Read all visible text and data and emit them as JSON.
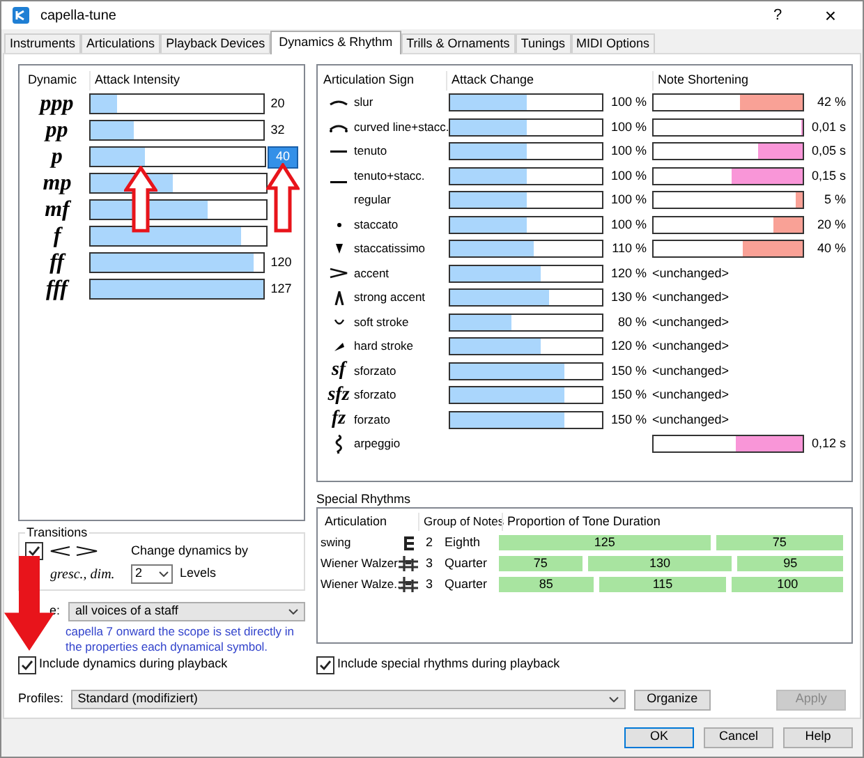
{
  "window": {
    "title": "capella-tune",
    "help": "?",
    "close": "×"
  },
  "tabs": [
    {
      "label": "Instruments",
      "selected": false
    },
    {
      "label": "Articulations",
      "selected": false
    },
    {
      "label": "Playback Devices",
      "selected": false
    },
    {
      "label": "Dynamics & Rhythm",
      "selected": true
    },
    {
      "label": "Trills & Ornaments",
      "selected": false
    },
    {
      "label": "Tunings",
      "selected": false
    },
    {
      "label": "MIDI Options",
      "selected": false
    }
  ],
  "dynamics": {
    "columns": [
      "Dynamic",
      "Attack Intensity"
    ],
    "rows": [
      {
        "dynamic": "ppp",
        "level": 0.16,
        "value": "20",
        "selected": false
      },
      {
        "dynamic": "pp",
        "level": 0.25,
        "value": "32",
        "selected": false
      },
      {
        "dynamic": "p",
        "level": 0.315,
        "value": "40",
        "selected": true
      },
      {
        "dynamic": "mp",
        "level": 0.47,
        "selected": false
      },
      {
        "dynamic": "mf",
        "level": 0.67,
        "selected": false
      },
      {
        "dynamic": "f",
        "level": 0.86,
        "selected": false
      },
      {
        "dynamic": "ff",
        "level": 0.945,
        "value": "120",
        "selected": false
      },
      {
        "dynamic": "fff",
        "level": 1,
        "value": "127",
        "selected": false
      }
    ]
  },
  "transitions": {
    "title": "Transitions",
    "hairpin_checked": true,
    "text_label": "gresc., dim.",
    "change_label": "Change dynamics by",
    "levels_value": "2",
    "levels_label": "Levels"
  },
  "scope": {
    "label": "e:",
    "value": "all voices of a staff"
  },
  "note": "capella 7 onward the scope is set directly in the properties each dynamical symbol.",
  "include_dynamics": {
    "label": "Include dynamics during playback",
    "checked": true
  },
  "articulations": {
    "columns": [
      "Articulation Sign",
      "Attack Change",
      "Note Shortening"
    ],
    "rows": [
      {
        "kind": "slur",
        "name": "slur",
        "attack": {
          "level": 0.5,
          "reading": "100 %"
        },
        "shortening": {
          "level": 0.42,
          "color": "#f9a196",
          "reading": "42 %"
        }
      },
      {
        "kind": "curved-stacc",
        "name": "curved line+stacc.",
        "attack": {
          "level": 0.5,
          "reading": "100 %"
        },
        "shortening": {
          "level": 0.01,
          "color": "#f996d8",
          "reading": "0,01 s"
        }
      },
      {
        "kind": "tenuto",
        "name": "tenuto",
        "attack": {
          "level": 0.5,
          "reading": "100 %"
        },
        "shortening": {
          "level": 0.3,
          "color": "#f996d8",
          "reading": "0,05 s"
        }
      },
      {
        "kind": "tenuto-stacc",
        "name": "tenuto+stacc.",
        "attack": {
          "level": 0.5,
          "reading": "100 %"
        },
        "shortening": {
          "level": 0.48,
          "color": "#f996d8",
          "reading": "0,15 s"
        }
      },
      {
        "kind": "none",
        "name": "regular",
        "attack": {
          "level": 0.5,
          "reading": "100 %"
        },
        "shortening": {
          "level": 0.05,
          "color": "#f9a196",
          "reading": "5 %"
        }
      },
      {
        "kind": "dot",
        "name": "staccato",
        "attack": {
          "level": 0.5,
          "reading": "100 %"
        },
        "shortening": {
          "level": 0.2,
          "color": "#f9a196",
          "reading": "20 %"
        }
      },
      {
        "kind": "wedge",
        "name": "staccatissimo",
        "attack": {
          "level": 0.55,
          "reading": "110 %"
        },
        "shortening": {
          "level": 0.4,
          "color": "#f9a196",
          "reading": "40 %"
        }
      },
      {
        "kind": "accent",
        "name": "accent",
        "attack": {
          "level": 0.6,
          "reading": "120 %"
        },
        "shortening": {
          "reading": "<unchanged>"
        }
      },
      {
        "kind": "strong-accent",
        "name": "strong accent",
        "attack": {
          "level": 0.65,
          "reading": "130 %"
        },
        "shortening": {
          "reading": "<unchanged>"
        }
      },
      {
        "kind": "soft-stroke",
        "name": "soft stroke",
        "attack": {
          "level": 0.4,
          "reading": "80 %"
        },
        "shortening": {
          "reading": "<unchanged>"
        }
      },
      {
        "kind": "hard-stroke",
        "name": "hard stroke",
        "attack": {
          "level": 0.6,
          "reading": "120 %"
        },
        "shortening": {
          "reading": "<unchanged>"
        }
      },
      {
        "kind": "text",
        "sign": "sf",
        "name": "sforzato",
        "attack": {
          "level": 0.75,
          "reading": "150 %"
        },
        "shortening": {
          "reading": "<unchanged>"
        }
      },
      {
        "kind": "text",
        "sign": "sfz",
        "name": "sforzato",
        "attack": {
          "level": 0.75,
          "reading": "150 %"
        },
        "shortening": {
          "reading": "<unchanged>"
        }
      },
      {
        "kind": "text",
        "sign": "fz",
        "name": "forzato",
        "attack": {
          "level": 0.75,
          "reading": "150 %"
        },
        "shortening": {
          "reading": "<unchanged>"
        }
      },
      {
        "kind": "arpeggio",
        "name": "arpeggio",
        "shortening": {
          "level": 0.45,
          "color": "#f996d8",
          "reading": "0,12 s"
        }
      }
    ]
  },
  "special_rhythms": {
    "title": "Special Rhythms",
    "columns": [
      "Articulation",
      "Group of Notes",
      "Proportion of Tone Duration"
    ],
    "rows": [
      {
        "name": "swing",
        "count": "2",
        "note": "Eighth",
        "proportions": [
          "125",
          "75"
        ]
      },
      {
        "name": "Wiener Walzer",
        "count": "3",
        "note": "Quarter",
        "proportions": [
          "75",
          "130",
          "95"
        ]
      },
      {
        "name": "Wiener Walze...",
        "count": "3",
        "note": "Quarter",
        "proportions": [
          "85",
          "115",
          "100"
        ]
      }
    ]
  },
  "include_rhythms": {
    "label": "Include special rhythms during playback",
    "checked": true
  },
  "profiles": {
    "label": "Profiles:",
    "value": "Standard (modifiziert)",
    "organize": "Organize",
    "apply": "Apply",
    "apply_disabled": true
  },
  "buttons": [
    "OK",
    "Cancel",
    "Help"
  ]
}
